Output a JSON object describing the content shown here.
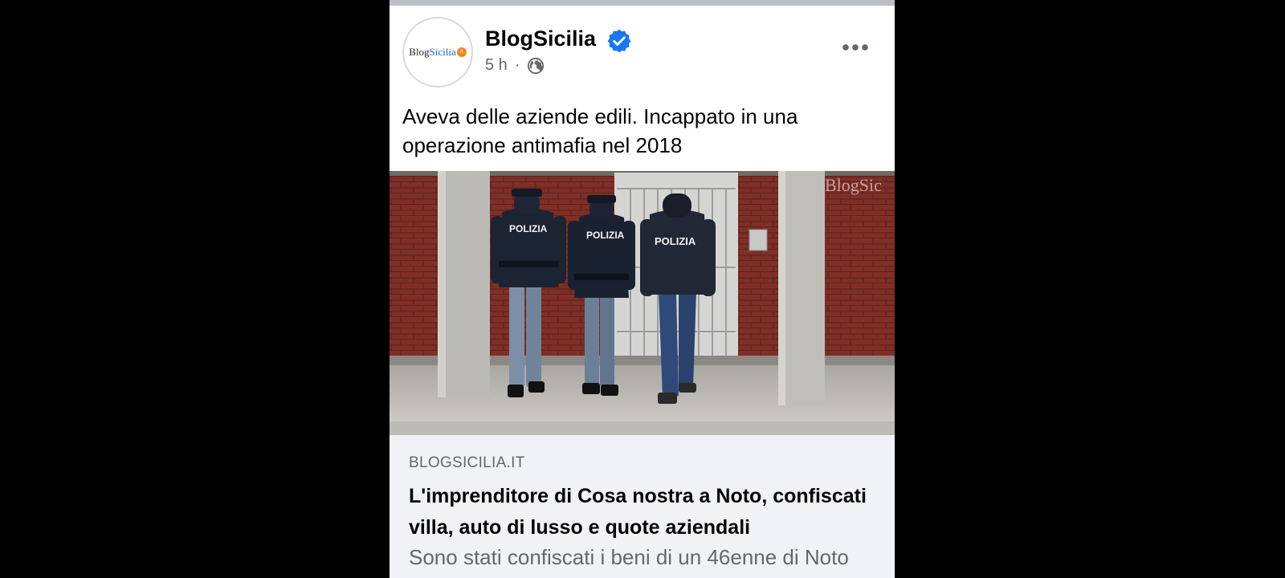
{
  "post": {
    "author": "BlogSicilia",
    "avatar_logo": {
      "part1": "Blog",
      "part2": "Sicilia",
      "badge": "it"
    },
    "time": "5 h",
    "separator": "·",
    "privacy_icon": "globe-icon",
    "verified_icon": "verified-badge-icon",
    "more_icon": "more-options-icon",
    "caption": "Aveva delle aziende edili. Incappato in una operazione antimafia nel 2018"
  },
  "image": {
    "officer_label": "POLIZIA",
    "watermark": "BlogSic"
  },
  "link_preview": {
    "domain": "BLOGSICILIA.IT",
    "headline": "L'imprenditore di Cosa nostra a Noto, confiscati villa, auto di lusso e quote aziendali",
    "description": "Sono stati confiscati i beni di un 46enne di Noto"
  },
  "colors": {
    "verified": "#1877f2",
    "secondary_text": "#65676b",
    "preview_bg": "#f0f2f5"
  }
}
